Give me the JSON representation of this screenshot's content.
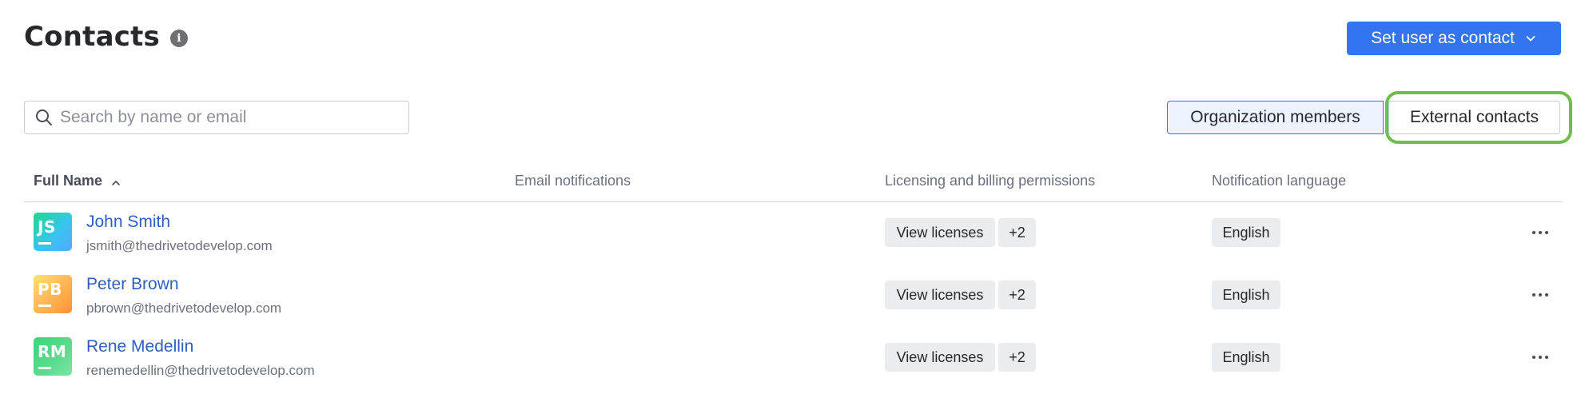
{
  "header": {
    "title": "Contacts",
    "info_icon": "info-icon",
    "action_button_label": "Set user as contact"
  },
  "search": {
    "placeholder": "Search by name or email",
    "value": ""
  },
  "toggle": {
    "options": [
      "Organization members",
      "External contacts"
    ],
    "selected": "Organization members",
    "highlighted": "External contacts"
  },
  "table": {
    "columns": [
      "Full Name",
      "Email notifications",
      "Licensing and billing permissions",
      "Notification language"
    ],
    "sort": {
      "column": "Full Name",
      "direction": "ascending"
    },
    "rows": [
      {
        "initials": "JS",
        "name": "John Smith",
        "email": "jsmith@thedrivetodevelop.com",
        "license_label": "View licenses",
        "license_more": "+2",
        "language": "English"
      },
      {
        "initials": "PB",
        "name": "Peter Brown",
        "email": "pbrown@thedrivetodevelop.com",
        "license_label": "View licenses",
        "license_more": "+2",
        "language": "English"
      },
      {
        "initials": "RM",
        "name": "Rene Medellin",
        "email": "renemedellin@thedrivetodevelop.com",
        "license_label": "View licenses",
        "license_more": "+2",
        "language": "English"
      }
    ]
  },
  "colors": {
    "accent": "#3574f0",
    "link": "#2f5fbf",
    "highlight_ring": "#6cc04a",
    "chip_bg": "#ebecf0"
  }
}
